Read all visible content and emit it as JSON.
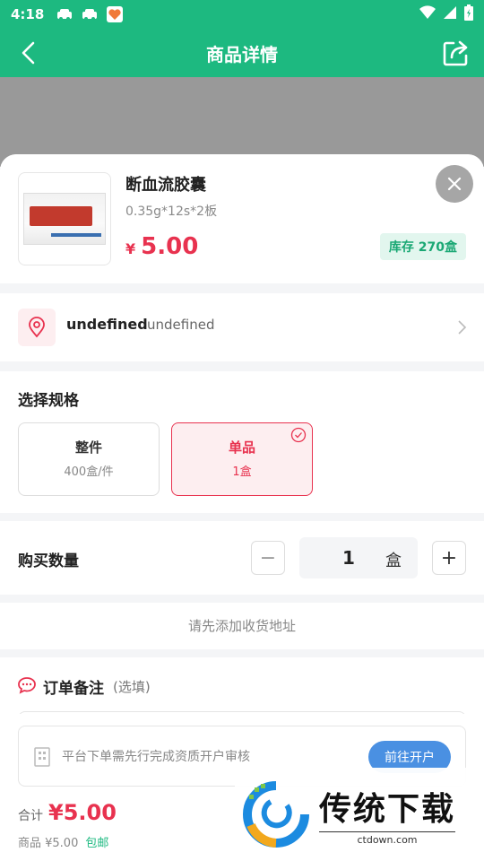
{
  "status_bar": {
    "time": "4:18"
  },
  "header": {
    "title": "商品详情"
  },
  "product": {
    "name": "断血流胶囊",
    "spec": "0.35g*12s*2板",
    "currency": "¥",
    "price": "5.00",
    "stock": "库存 270盒"
  },
  "address": {
    "name": "undefined",
    "detail": "undefined"
  },
  "spec_section": {
    "title": "选择规格",
    "options": [
      {
        "label": "整件",
        "sub": "400盒/件",
        "selected": false
      },
      {
        "label": "单品",
        "sub": "1盒",
        "selected": true
      }
    ]
  },
  "quantity": {
    "title": "购买数量",
    "value": "1",
    "unit": "盒",
    "minus": "−",
    "plus": "+"
  },
  "notice": "请先添加收货地址",
  "remark": {
    "title": "订单备注",
    "optional": "(选填)"
  },
  "qualification": {
    "text": "平台下单需先行完成资质开户审核",
    "button": "前往开户"
  },
  "summary": {
    "total_label": "合计",
    "total": "¥5.00",
    "goods_label": "商品 ¥5.00",
    "shipping": "包邮"
  },
  "watermark": {
    "title": "传统下载",
    "url": "ctdown.com"
  },
  "colors": {
    "brand": "#1db980",
    "accent": "#e8324f",
    "stock_bg": "#e2f6ee"
  }
}
